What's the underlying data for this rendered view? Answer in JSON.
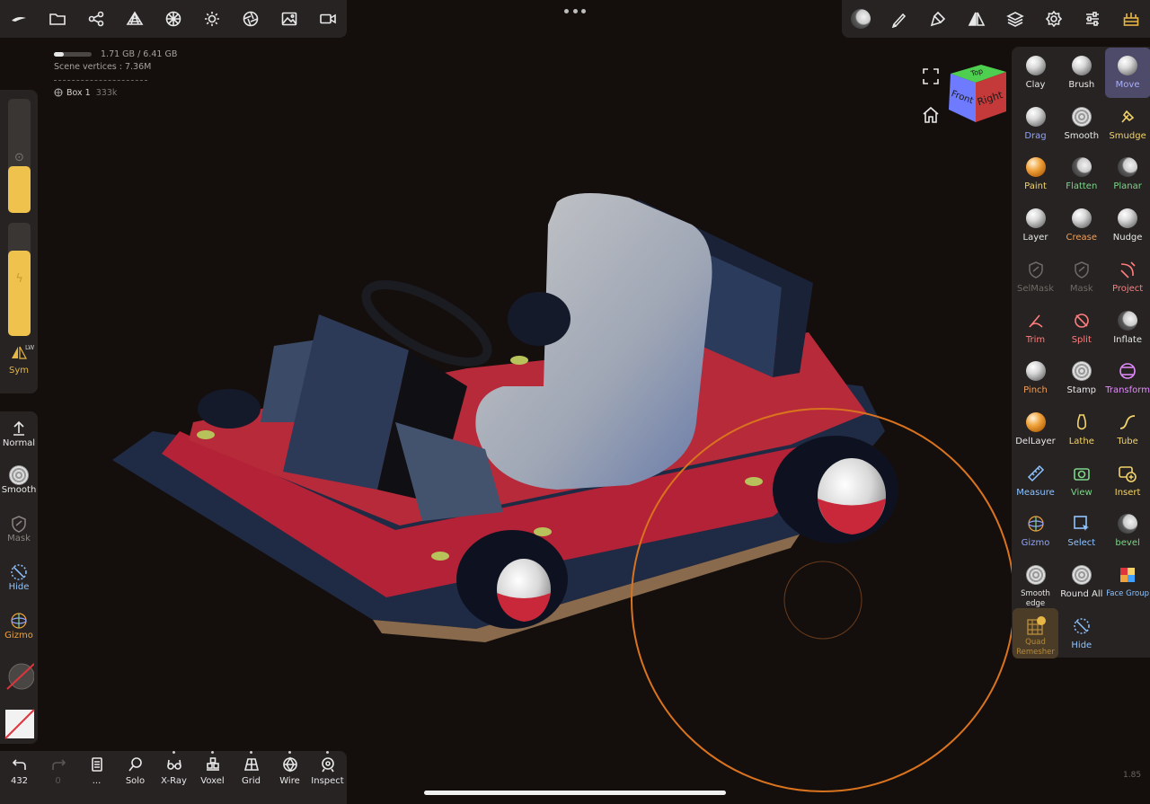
{
  "stats": {
    "memory": "1.71 GB / 6.41 GB",
    "memory_fraction": 0.27,
    "vertices": "Scene vertices : 7.36M",
    "object_name": "Box 1",
    "object_count": "333k"
  },
  "left_panel": {
    "sym_label": "Sym",
    "sym_badge": "LW",
    "tools": [
      {
        "label": "Normal",
        "color": "#e8e8e8"
      },
      {
        "label": "Smooth",
        "color": "#e8e8e8"
      },
      {
        "label": "Mask",
        "color": "#8b8480"
      },
      {
        "label": "Hide",
        "color": "#8fc3ff"
      },
      {
        "label": "Gizmo",
        "color": "#f0a23c"
      }
    ]
  },
  "bottom_bar": [
    {
      "label": "432",
      "icon": "undo-icon"
    },
    {
      "label": "0",
      "icon": "redo-icon"
    },
    {
      "label": "...",
      "icon": "book-icon"
    },
    {
      "label": "Solo",
      "icon": "search-icon"
    },
    {
      "label": "X-Ray",
      "icon": "glasses-icon"
    },
    {
      "label": "Voxel",
      "icon": "cubes-icon"
    },
    {
      "label": "Grid",
      "icon": "grid-plane-icon"
    },
    {
      "label": "Wire",
      "icon": "wire-sphere-icon"
    },
    {
      "label": "Inspect",
      "icon": "inspect-icon"
    }
  ],
  "view_cube": {
    "top": "Top",
    "front": "Front",
    "right": "Right"
  },
  "tools": [
    {
      "label": "Clay",
      "color": "#e8e8e8",
      "icon": "sph"
    },
    {
      "label": "Brush",
      "color": "#e8e8e8",
      "icon": "sph"
    },
    {
      "label": "Move",
      "color": "#a9b0ff",
      "icon": "sph"
    },
    {
      "label": "Drag",
      "color": "#8fa5ff",
      "icon": "sph"
    },
    {
      "label": "Smooth",
      "color": "#e8e8e8",
      "icon": "sph-tex"
    },
    {
      "label": "Smudge",
      "color": "#f3d36a",
      "icon": "smudge"
    },
    {
      "label": "Paint",
      "color": "#f3d36a",
      "icon": "sph-orange"
    },
    {
      "label": "Flatten",
      "color": "#7fd58a",
      "icon": "sph-moon"
    },
    {
      "label": "Planar",
      "color": "#7fd58a",
      "icon": "sph-moon"
    },
    {
      "label": "Layer",
      "color": "#e8e8e8",
      "icon": "sph"
    },
    {
      "label": "Crease",
      "color": "#f0a05a",
      "icon": "sph"
    },
    {
      "label": "Nudge",
      "color": "#e8e8e8",
      "icon": "sph"
    },
    {
      "label": "SelMask",
      "color": "#6f6a66",
      "icon": "mask"
    },
    {
      "label": "Mask",
      "color": "#6f6a66",
      "icon": "mask"
    },
    {
      "label": "Project",
      "color": "#ff7d7d",
      "icon": "project"
    },
    {
      "label": "Trim",
      "color": "#ff7d7d",
      "icon": "trim"
    },
    {
      "label": "Split",
      "color": "#ff7d7d",
      "icon": "split"
    },
    {
      "label": "Inflate",
      "color": "#e8e8e8",
      "icon": "sph-moon"
    },
    {
      "label": "Pinch",
      "color": "#f0a05a",
      "icon": "sph"
    },
    {
      "label": "Stamp",
      "color": "#e8e8e8",
      "icon": "sph-tex"
    },
    {
      "label": "Transform",
      "color": "#e58cff",
      "icon": "transform"
    },
    {
      "label": "DelLayer",
      "color": "#e8e8e8",
      "icon": "sph-orange"
    },
    {
      "label": "Lathe",
      "color": "#f3d36a",
      "icon": "lathe"
    },
    {
      "label": "Tube",
      "color": "#f3d36a",
      "icon": "tube"
    },
    {
      "label": "Measure",
      "color": "#8fc3ff",
      "icon": "measure"
    },
    {
      "label": "View",
      "color": "#7fd58a",
      "icon": "camera"
    },
    {
      "label": "Insert",
      "color": "#f3d36a",
      "icon": "insert"
    },
    {
      "label": "Gizmo",
      "color": "#8fa5ff",
      "icon": "gizmo"
    },
    {
      "label": "Select",
      "color": "#8fc3ff",
      "icon": "select"
    },
    {
      "label": "bevel",
      "color": "#7fd58a",
      "icon": "sph-moon"
    },
    {
      "label": "Smooth edge",
      "color": "#e8e8e8",
      "icon": "sph-tex"
    },
    {
      "label": "Round All",
      "color": "#e8e8e8",
      "icon": "sph-tex"
    },
    {
      "label": "Face Group",
      "color": "#8fc3ff",
      "icon": "facegroup"
    },
    {
      "label": "Quad Remesher",
      "color": "#b58a3c",
      "icon": "quad"
    },
    {
      "label": "Hide",
      "color": "#8fc3ff",
      "icon": "hide"
    }
  ],
  "scale": "1.85"
}
